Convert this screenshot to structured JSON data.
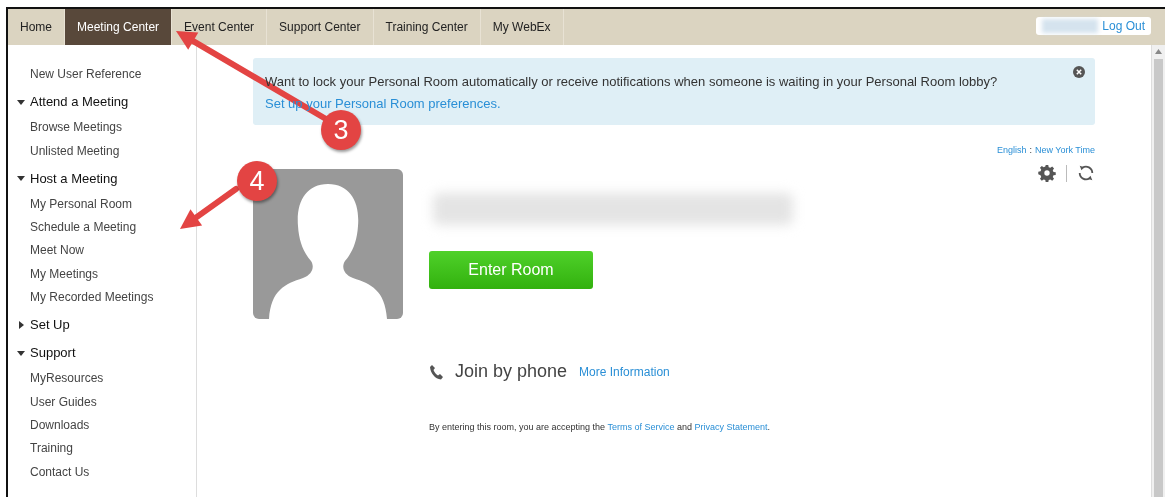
{
  "nav": {
    "tabs": [
      {
        "label": "Home",
        "selected": false
      },
      {
        "label": "Meeting Center",
        "selected": true
      },
      {
        "label": "Event Center",
        "selected": false
      },
      {
        "label": "Support Center",
        "selected": false
      },
      {
        "label": "Training Center",
        "selected": false
      },
      {
        "label": "My WebEx",
        "selected": false
      }
    ],
    "logout": "Log Out"
  },
  "sidebar": {
    "items": [
      {
        "kind": "link",
        "label": "New User Reference"
      },
      {
        "kind": "section",
        "label": "Attend a Meeting",
        "expanded": true,
        "children": [
          {
            "label": "Browse Meetings"
          },
          {
            "label": "Unlisted Meeting"
          }
        ]
      },
      {
        "kind": "section",
        "label": "Host a Meeting",
        "expanded": true,
        "children": [
          {
            "label": "My Personal Room"
          },
          {
            "label": "Schedule a Meeting"
          },
          {
            "label": "Meet Now"
          },
          {
            "label": "My Meetings"
          },
          {
            "label": "My Recorded Meetings"
          }
        ]
      },
      {
        "kind": "section",
        "label": "Set Up",
        "expanded": false
      },
      {
        "kind": "section",
        "label": "Support",
        "expanded": true,
        "children": [
          {
            "label": "MyResources"
          },
          {
            "label": "User Guides"
          },
          {
            "label": "Downloads"
          },
          {
            "label": "Training"
          },
          {
            "label": "Contact Us"
          }
        ]
      }
    ]
  },
  "notice": {
    "text": "Want to lock your Personal Room automatically or receive notifications when someone is waiting in your Personal Room lobby?",
    "link": "Set up your Personal Room preferences."
  },
  "locale": {
    "language": "English",
    "separator": ":",
    "timezone": "New York Time"
  },
  "room": {
    "enter_button": "Enter Room",
    "join_heading": "Join by phone",
    "join_link": "More Information",
    "terms": {
      "before": "By entering this room, you are accepting the",
      "link1": "Terms of Service",
      "middle": "and",
      "link2": "Privacy Statement",
      "after": "."
    }
  },
  "annotations": [
    {
      "label": "3"
    },
    {
      "label": "4"
    }
  ]
}
